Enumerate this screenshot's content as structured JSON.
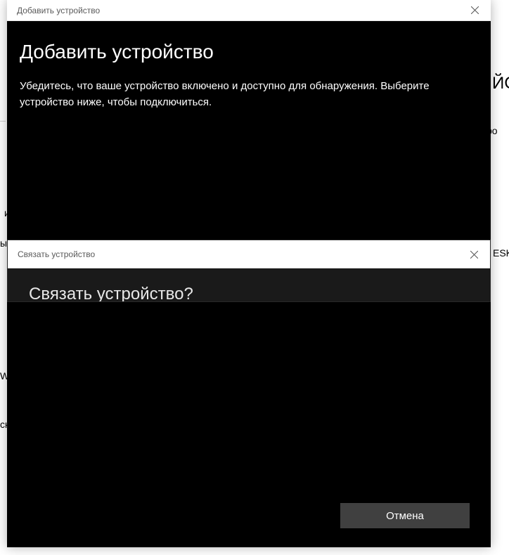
{
  "background": {
    "fragments": [
      "ЙС",
      "ро",
      "и",
      "ы",
      "ESK",
      "Wi",
      "ск"
    ]
  },
  "dialog1": {
    "titlebar": "Добавить устройство",
    "title": "Добавить устройство",
    "subtitle": "Убедитесь, что ваше устройство включено и доступно для обнаружения. Выберите устройство ниже, чтобы подключиться.",
    "cancel_label": "Отмена"
  },
  "dialog2": {
    "titlebar": "Связать устройство",
    "title": "Связать устройство?"
  }
}
